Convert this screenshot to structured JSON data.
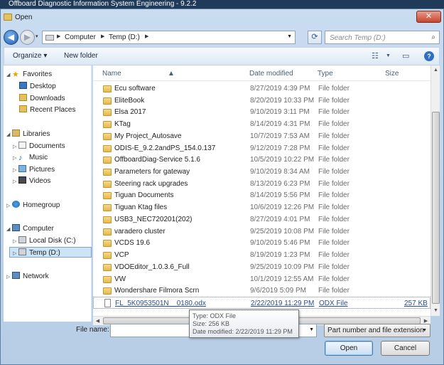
{
  "app": {
    "title": "Offboard Diagnostic Information System Engineering - 9.2.2"
  },
  "dialog": {
    "title": "Open"
  },
  "address": {
    "crumbs": [
      "Computer",
      "Temp (D:)"
    ]
  },
  "search": {
    "placeholder": "Search Temp (D:)"
  },
  "toolbar": {
    "organize": "Organize ▾",
    "new_folder": "New folder"
  },
  "nav": {
    "favorites": "Favorites",
    "desktop": "Desktop",
    "downloads": "Downloads",
    "recent": "Recent Places",
    "libraries": "Libraries",
    "documents": "Documents",
    "music": "Music",
    "pictures": "Pictures",
    "videos": "Videos",
    "homegroup": "Homegroup",
    "computer": "Computer",
    "local_disk": "Local Disk (C:)",
    "temp": "Temp (D:)",
    "network": "Network"
  },
  "columns": {
    "name": "Name",
    "date": "Date modified",
    "type": "Type",
    "size": "Size"
  },
  "files": [
    {
      "name": "Ecu software",
      "date": "8/27/2019 4:39 PM",
      "type": "File folder",
      "size": ""
    },
    {
      "name": "EliteBook",
      "date": "8/20/2019 10:33 PM",
      "type": "File folder",
      "size": ""
    },
    {
      "name": "Elsa 2017",
      "date": "9/10/2019 3:11 PM",
      "type": "File folder",
      "size": ""
    },
    {
      "name": "KTag",
      "date": "8/14/2019 4:31 PM",
      "type": "File folder",
      "size": ""
    },
    {
      "name": "My Project_Autosave",
      "date": "10/7/2019 7:53 AM",
      "type": "File folder",
      "size": ""
    },
    {
      "name": "ODIS-E_9.2.2andPS_154.0.137",
      "date": "9/12/2019 7:28 PM",
      "type": "File folder",
      "size": ""
    },
    {
      "name": "OffboardDiag-Service 5.1.6",
      "date": "10/5/2019 10:22 PM",
      "type": "File folder",
      "size": ""
    },
    {
      "name": "Parameters for gateway",
      "date": "9/10/2019 8:34 AM",
      "type": "File folder",
      "size": ""
    },
    {
      "name": "Steering rack upgrades",
      "date": "8/13/2019 6:23 PM",
      "type": "File folder",
      "size": ""
    },
    {
      "name": "Tiguan Documents",
      "date": "8/14/2019 5:56 PM",
      "type": "File folder",
      "size": ""
    },
    {
      "name": "Tiguan Ktag files",
      "date": "10/6/2019 12:26 PM",
      "type": "File folder",
      "size": ""
    },
    {
      "name": "USB3_NEC720201(202)",
      "date": "8/27/2019 4:01 PM",
      "type": "File folder",
      "size": ""
    },
    {
      "name": "varadero cluster",
      "date": "9/25/2019 10:08 PM",
      "type": "File folder",
      "size": ""
    },
    {
      "name": "VCDS 19.6",
      "date": "9/10/2019 5:46 PM",
      "type": "File folder",
      "size": ""
    },
    {
      "name": "VCP",
      "date": "8/19/2019 1:23 PM",
      "type": "File folder",
      "size": ""
    },
    {
      "name": "VDOEditor_1.0.3.6_Full",
      "date": "9/25/2019 10:09 PM",
      "type": "File folder",
      "size": ""
    },
    {
      "name": "VW",
      "date": "10/1/2019 12:55 AM",
      "type": "File folder",
      "size": ""
    },
    {
      "name": "Wondershare Filmora Scrn",
      "date": "9/6/2019 5:09 PM",
      "type": "File folder",
      "size": ""
    },
    {
      "name": "FL_5K0953501N__0180.odx",
      "date": "2/22/2019 11:29 PM",
      "type": "ODX File",
      "size": "257 KB"
    }
  ],
  "tooltip": {
    "type": "Type: ODX File",
    "size": "Size: 256 KB",
    "date": "Date modified: 2/22/2019 11:29 PM"
  },
  "footer": {
    "file_name_label": "File name:",
    "file_name_value": "",
    "filter": "Part number and file extension",
    "open": "Open",
    "cancel": "Cancel"
  }
}
